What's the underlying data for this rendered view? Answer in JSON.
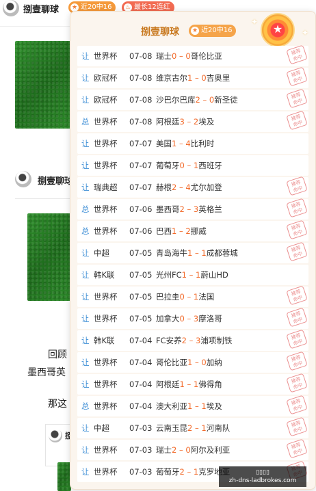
{
  "header": {
    "author": "捌壹聊球",
    "badges": [
      "近20中16",
      "最长12连红"
    ],
    "badge_icons": [
      "star-icon",
      "flame-icon"
    ]
  },
  "article": {
    "author": "捌壹聊球",
    "text_lines": [
      "回顾",
      "墨西哥英",
      "那这"
    ],
    "card_author": "捌"
  },
  "popup": {
    "title": "捌壹聊球",
    "badge": "近20中16",
    "hit_stamp": "推荐\n命中",
    "colors": {
      "title": "#c8781e",
      "type": "#3f8fd6",
      "score": "#f26a2a",
      "stamp": "#e56b6b"
    },
    "rows": [
      {
        "type": "让",
        "league": "世界杯",
        "date": "07-08",
        "home": "瑞士",
        "hs": "0",
        "as": "0",
        "away": "哥伦比亚",
        "hit": true
      },
      {
        "type": "让",
        "league": "欧冠杯",
        "date": "07-08",
        "home": "维京古尔",
        "hs": "1",
        "as": "0",
        "away": "吉奥里",
        "hit": true
      },
      {
        "type": "让",
        "league": "欧冠杯",
        "date": "07-08",
        "home": "沙巴尔巴库",
        "hs": "2",
        "as": "0",
        "away": "新圣徒",
        "hit": true
      },
      {
        "type": "总",
        "league": "世界杯",
        "date": "07-08",
        "home": "阿根廷",
        "hs": "3",
        "as": "2",
        "away": "埃及",
        "hit": true
      },
      {
        "type": "让",
        "league": "世界杯",
        "date": "07-07",
        "home": "美国",
        "hs": "1",
        "as": "4",
        "away": "比利时",
        "hit": false
      },
      {
        "type": "让",
        "league": "世界杯",
        "date": "07-07",
        "home": "葡萄牙",
        "hs": "0",
        "as": "1",
        "away": "西班牙",
        "hit": false
      },
      {
        "type": "让",
        "league": "瑞典超",
        "date": "07-07",
        "home": "赫根",
        "hs": "2",
        "as": "4",
        "away": "尤尔加登",
        "hit": true
      },
      {
        "type": "总",
        "league": "世界杯",
        "date": "07-06",
        "home": "墨西哥",
        "hs": "2",
        "as": "3",
        "away": "英格兰",
        "hit": true
      },
      {
        "type": "总",
        "league": "世界杯",
        "date": "07-06",
        "home": "巴西",
        "hs": "1",
        "as": "2",
        "away": "挪威",
        "hit": true
      },
      {
        "type": "让",
        "league": "中超",
        "date": "07-05",
        "home": "青岛海牛",
        "hs": "1",
        "as": "1",
        "away": "成都蓉城",
        "hit": true
      },
      {
        "type": "让",
        "league": "韩K联",
        "date": "07-05",
        "home": "光州FC",
        "hs": "1",
        "as": "1",
        "away": "蔚山HD",
        "hit": false
      },
      {
        "type": "让",
        "league": "世界杯",
        "date": "07-05",
        "home": "巴拉圭",
        "hs": "0",
        "as": "1",
        "away": "法国",
        "hit": true
      },
      {
        "type": "让",
        "league": "世界杯",
        "date": "07-05",
        "home": "加拿大",
        "hs": "0",
        "as": "3",
        "away": "摩洛哥",
        "hit": true
      },
      {
        "type": "让",
        "league": "韩K联",
        "date": "07-04",
        "home": "FC安养",
        "hs": "2",
        "as": "3",
        "away": "浦项制铁",
        "hit": true
      },
      {
        "type": "让",
        "league": "世界杯",
        "date": "07-04",
        "home": "哥伦比亚",
        "hs": "1",
        "as": "0",
        "away": "加纳",
        "hit": true
      },
      {
        "type": "让",
        "league": "世界杯",
        "date": "07-04",
        "home": "阿根廷",
        "hs": "1",
        "as": "1",
        "away": "佛得角",
        "hit": true
      },
      {
        "type": "总",
        "league": "世界杯",
        "date": "07-04",
        "home": "澳大利亚",
        "hs": "1",
        "as": "1",
        "away": "埃及",
        "hit": true
      },
      {
        "type": "让",
        "league": "中超",
        "date": "07-03",
        "home": "云南玉昆",
        "hs": "2",
        "as": "1",
        "away": "河南队",
        "hit": true
      },
      {
        "type": "让",
        "league": "世界杯",
        "date": "07-03",
        "home": "瑞士",
        "hs": "2",
        "as": "0",
        "away": "阿尔及利亚",
        "hit": true
      },
      {
        "type": "让",
        "league": "世界杯",
        "date": "07-03",
        "home": "葡萄牙",
        "hs": "2",
        "as": "1",
        "away": "克罗地亚",
        "hit": true
      }
    ]
  },
  "watermark": {
    "title": "▯▯▯▯",
    "url": "zh-dns-ladbrokes.com"
  }
}
